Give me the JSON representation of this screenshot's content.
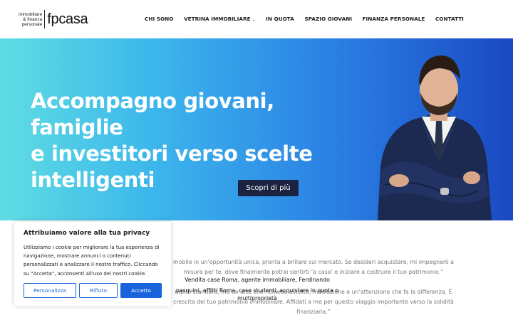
{
  "logo": {
    "line1": "immobiliare",
    "line2": "& finanza",
    "line3": "personale",
    "brand": "fpcasa"
  },
  "nav": {
    "items": [
      {
        "label": "CHI SONO",
        "has_dropdown": false
      },
      {
        "label": "VETRINA IMMOBILIARE",
        "has_dropdown": true
      },
      {
        "label": "IN QUOTA",
        "has_dropdown": false
      },
      {
        "label": "SPAZIO GIOVANI",
        "has_dropdown": false
      },
      {
        "label": "FINANZA PERSONALE",
        "has_dropdown": false
      },
      {
        "label": "CONTATTI",
        "has_dropdown": false
      }
    ],
    "dropdown_icon": "chevron-down-icon"
  },
  "hero": {
    "title_line1": "Accompagno giovani, famiglie",
    "title_line2": "e investitori verso scelte",
    "title_line3": "intelligenti",
    "cta_label": "Scopri di più",
    "colors": {
      "gradient_start": "#5fdde2",
      "gradient_end": "#1a48c2",
      "cta_bg": "#1b2340"
    }
  },
  "body": {
    "para1_line1": "mobile in un’opportunità unica, pronta a brillare sul mercato. Se desideri acquistare, mi impegnerò a",
    "para1_line2": "misura per te, dove finalmente potrai sentirti ‘a casa’ e iniziare a costruire il tuo patrimonio.”",
    "para2_line1": "mpito standard, ma un’arte che richiede ascolto, mediazione e un’attenzione che fa la differenza. È",
    "para2_line2": "crescita del tuo patrimonio immobiliare. Affidati a me per questo viaggio importante verso la solidità",
    "para2_line3": "finanziaria.”",
    "alt_line1": "Vendita case Roma, agente immobiliare, Ferdinando",
    "alt_line2": "pasquini, affitti Roma, case studenti, acquistare in quota o",
    "alt_line3": "multiproprietà"
  },
  "cookie_banner": {
    "title": "Attribuiamo valore alla tua privacy",
    "text_line1": "Utilizziamo i cookie per migliorare la tua esperienza di",
    "text_line2": "navigazione, mostrare annunci o contenuti",
    "text_line3": "personalizzati e analizzare il nostro traffico. Cliccando",
    "text_line4": "su \"Accetta\", acconsenti all'uso dei nostri cookie.",
    "customize_label": "Personalizza",
    "reject_label": "Rifiuto",
    "accept_label": "Accetto",
    "accent_color": "#1863dc"
  }
}
